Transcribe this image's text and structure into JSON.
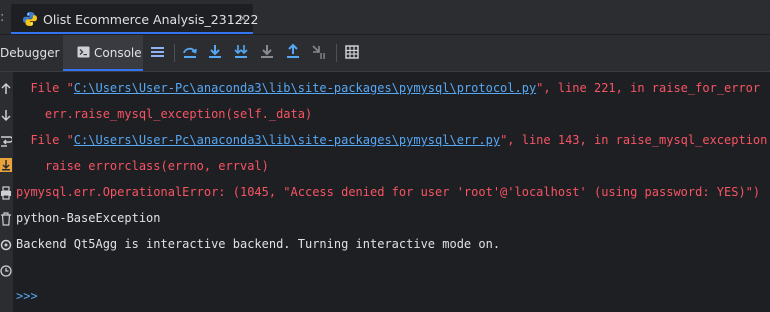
{
  "tab": {
    "edge_char": ":",
    "title": "Olist Ecommerce Analysis_231222",
    "close": "×"
  },
  "toolbar": {
    "debugger_label": "Debugger",
    "console_label": "Console"
  },
  "console": {
    "l1": {
      "pre": "  File \"",
      "link": "C:\\Users\\User-Pc\\anaconda3\\lib\\site-packages\\pymysql\\protocol.py",
      "post": "\", line 221, in raise_for_error"
    },
    "l2": "    err.raise_mysql_exception(self._data)",
    "l3": {
      "pre": "  File \"",
      "link": "C:\\Users\\User-Pc\\anaconda3\\lib\\site-packages\\pymysql\\err.py",
      "post": "\", line 143, in raise_mysql_exception"
    },
    "l4": "    raise errorclass(errno, errval)",
    "l5": "pymysql.err.OperationalError: (1045, \"Access denied for user 'root'@'localhost' (using password: YES)\")",
    "l6": "python-BaseException",
    "l7": "Backend Qt5Agg is interactive backend. Turning interactive mode on.",
    "prompt": ">>>"
  },
  "colors": {
    "error": "#f75464",
    "link": "#56a8f5",
    "text": "#dfe1e5",
    "accent": "#3574f0"
  },
  "icons": [
    "python-file-icon",
    "console-icon",
    "threads-icon",
    "step-over-icon",
    "step-into-icon",
    "force-step-into-icon",
    "step-out-icon",
    "run-to-cursor-icon",
    "evaluate-icon",
    "table-icon"
  ]
}
